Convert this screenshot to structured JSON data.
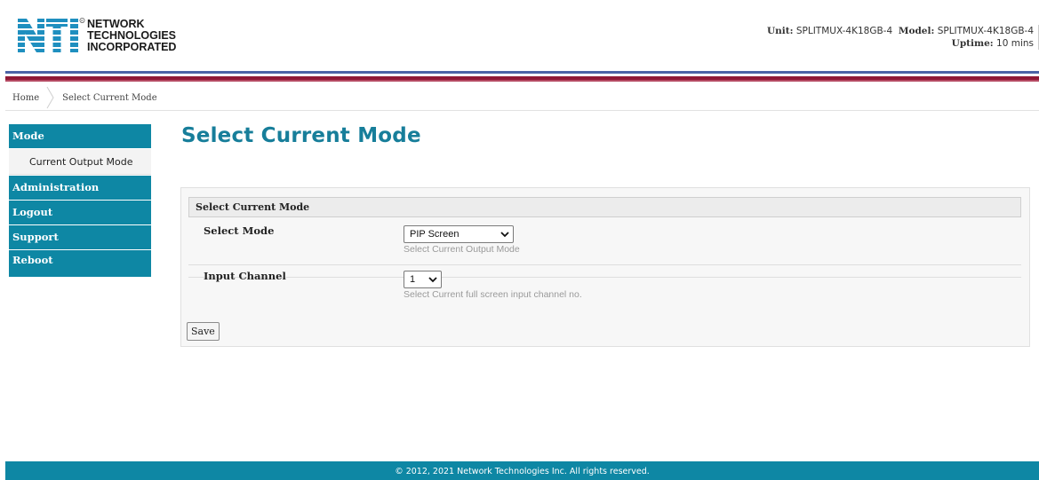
{
  "header": {
    "logo_letters": "NTI",
    "logo_lines": [
      "NETWORK",
      "TECHNOLOGIES",
      "INCORPORATED"
    ],
    "unit_label": "Unit:",
    "unit_value": "SPLITMUX-4K18GB-4",
    "model_label": "Model:",
    "model_value": "SPLITMUX-4K18GB-4",
    "uptime_label": "Uptime:",
    "uptime_value": "10 mins"
  },
  "breadcrumb": {
    "home": "Home",
    "current": "Select Current Mode"
  },
  "sidebar": {
    "items": [
      {
        "label": "Mode"
      },
      {
        "label": "Current Output Mode"
      },
      {
        "label": "Administration"
      },
      {
        "label": "Logout"
      },
      {
        "label": "Support"
      },
      {
        "label": "Reboot"
      }
    ]
  },
  "main": {
    "title": "Select Current Mode",
    "panel_title": "Select Current Mode",
    "rows": [
      {
        "label": "Select Mode",
        "selected": "PIP Screen",
        "hint": "Select Current Output Mode"
      },
      {
        "label": "Input Channel",
        "selected": "1",
        "hint": "Select Current full screen input channel no."
      }
    ],
    "save_label": "Save"
  },
  "footer": {
    "text": "© 2012, 2021 Network Technologies Inc. All rights reserved."
  },
  "colors": {
    "accent": "#0e87a4",
    "title": "#177e9a",
    "stripe_blue": "#4b63a6",
    "stripe_red": "#8f1936",
    "logo_blue": "#1f8fbf"
  }
}
